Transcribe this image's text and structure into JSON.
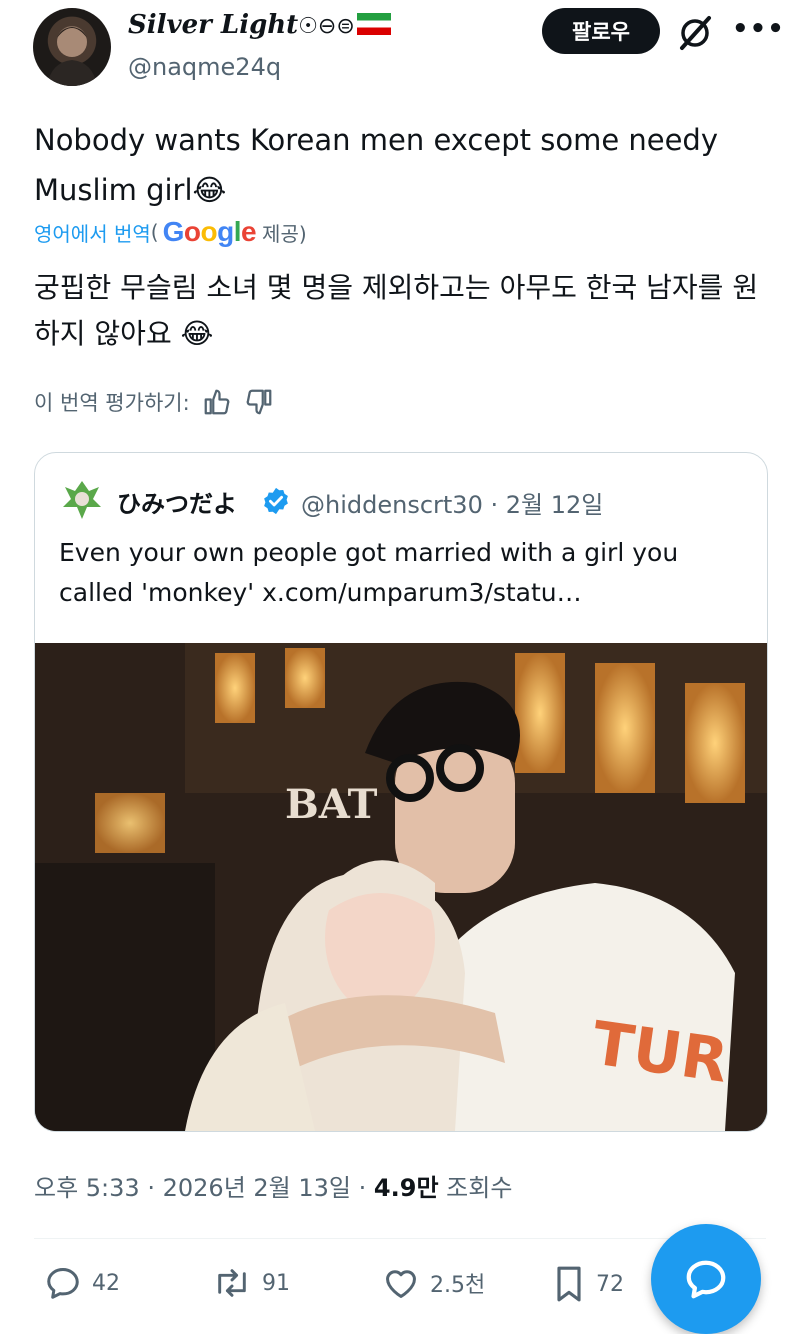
{
  "header": {
    "display_name": "Silver Light",
    "name_symbols": "☉⊖⊜",
    "handle": "@naqme24q",
    "follow_label": "팔로우"
  },
  "tweet": {
    "text": "Nobody wants Korean men except some needy Muslim girl😂",
    "translate_link": "영어에서 번역",
    "translate_prefix": "(",
    "translate_suffix": "제공)",
    "translated_text": "궁핍한 무슬림 소녀 몇 명을 제외하고는 아무도 한국 남자를 원하지 않아요 😂",
    "rate_label": "이 번역 평가하기:"
  },
  "quote": {
    "name": "ひみつだよ",
    "handle": "@hiddenscrt30",
    "separator": "·",
    "date": "2월 12일",
    "text": "Even your own people got married with a girl you called 'monkey'  x.com/umparum3/statu…",
    "photo_sign_text": "BAT",
    "shirt_text": "TUR"
  },
  "meta": {
    "time": "오후 5:33",
    "date": "2026년 2월 13일",
    "views_value": "4.9만",
    "views_label": "조회수",
    "sep": "·"
  },
  "actions": {
    "replies": "42",
    "reposts": "91",
    "likes": "2.5천",
    "bookmarks": "72"
  },
  "colors": {
    "accent": "#1d9bf0",
    "text": "#0f1419",
    "secondary": "#536471"
  }
}
